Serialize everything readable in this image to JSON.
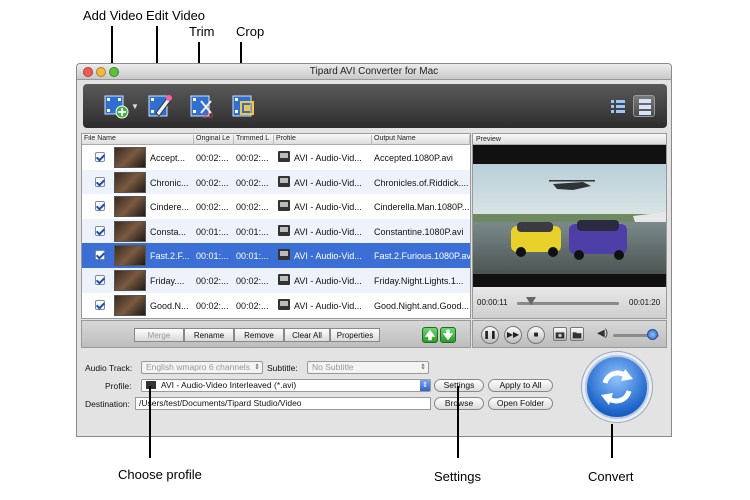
{
  "callouts": {
    "add_video": "Add Video",
    "edit_video": "Edit Video",
    "trim": "Trim",
    "crop": "Crop",
    "choose_profile": "Choose profile",
    "settings": "Settings",
    "convert": "Convert"
  },
  "window": {
    "title": "Tipard AVI Converter for Mac"
  },
  "list": {
    "headers": [
      "File Name",
      "Original Le",
      "Trimmed L",
      "Profile",
      "Output Name"
    ],
    "rows": [
      {
        "name": "Accept...",
        "orig": "00:02:...",
        "trim": "00:02:...",
        "profile": "AVI - Audio-Vid...",
        "output": "Accepted.1080P.avi",
        "state": "normal"
      },
      {
        "name": "Chronic...",
        "orig": "00:02:...",
        "trim": "00:02:...",
        "profile": "AVI - Audio-Vid...",
        "output": "Chronicles.of.Riddick....",
        "state": "alt"
      },
      {
        "name": "Cindere...",
        "orig": "00:02:...",
        "trim": "00:02:...",
        "profile": "AVI - Audio-Vid...",
        "output": "Cinderella.Man.1080P....",
        "state": "normal"
      },
      {
        "name": "Consta...",
        "orig": "00:01:...",
        "trim": "00:01:...",
        "profile": "AVI - Audio-Vid...",
        "output": "Constantine.1080P.avi",
        "state": "alt"
      },
      {
        "name": "Fast.2.F...",
        "orig": "00:01:...",
        "trim": "00:01:...",
        "profile": "AVI - Audio-Vid...",
        "output": "Fast.2.Furious.1080P.avi",
        "state": "sel"
      },
      {
        "name": "Friday....",
        "orig": "00:02:...",
        "trim": "00:02:...",
        "profile": "AVI - Audio-Vid...",
        "output": "Friday.Night.Lights.1...",
        "state": "alt"
      },
      {
        "name": "Good.N...",
        "orig": "00:02:...",
        "trim": "00:02:...",
        "profile": "AVI - Audio-Vid...",
        "output": "Good.Night.and.Good....",
        "state": "normal"
      }
    ]
  },
  "preview": {
    "label": "Preview",
    "time_current": "00:00:11",
    "time_total": "00:01:20",
    "progress": 0.14
  },
  "buttons": {
    "merge": "Merge",
    "rename": "Rename",
    "remove": "Remove",
    "clear_all": "Clear All",
    "properties": "Properties"
  },
  "options": {
    "audio_track_label": "Audio Track:",
    "audio_track_value": "English wmapro 6 channels",
    "subtitle_label": "Subtitle:",
    "subtitle_value": "No Subtitle",
    "profile_label": "Profile:",
    "profile_value": "AVI - Audio-Video Interleaved (*.avi)",
    "settings": "Settings",
    "apply_to_all": "Apply to All",
    "destination_label": "Destination:",
    "destination_value": "/Users/test/Documents/Tipard Studio/Video",
    "browse": "Browse",
    "open_folder": "Open Folder"
  },
  "volume": 0.85,
  "colors": {
    "selection": "#3b6fd6",
    "accent": "#1d64c9"
  }
}
